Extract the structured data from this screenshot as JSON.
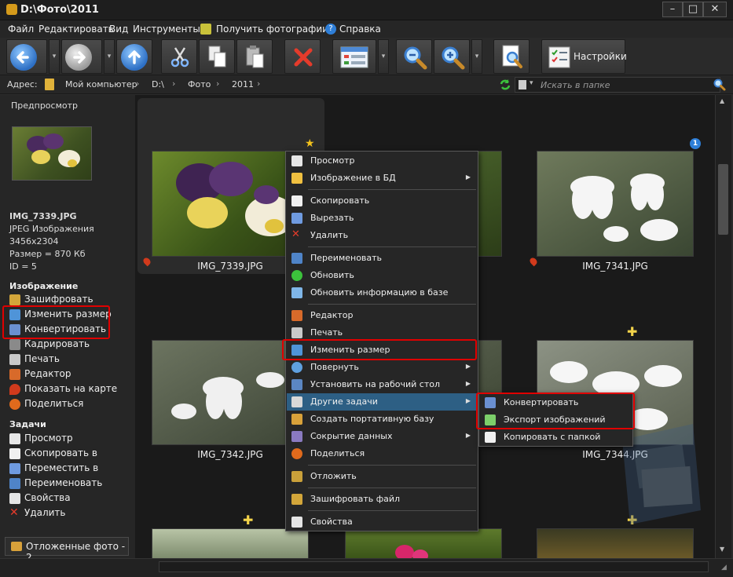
{
  "window": {
    "title": "D:\\Фото\\2011"
  },
  "menu": {
    "file": "Файл",
    "edit": "Редактировать",
    "view": "Вид",
    "tools": "Инструменты",
    "get_photos": "Получить фотографии",
    "help": "Справка"
  },
  "toolbar": {
    "settings_label": "Настройки"
  },
  "address": {
    "label": "Адрес:",
    "crumbs": [
      "Мой компьютер",
      "D:\\",
      "Фото",
      "2011"
    ],
    "search_placeholder": "Искать в папке"
  },
  "sidebar": {
    "preview_header": "Предпросмотр",
    "file": {
      "name": "IMG_7339.JPG",
      "type": "JPEG Изображения",
      "dimensions": "3456x2304",
      "size": "Размер = 870 Кб",
      "id": "ID = 5"
    },
    "image_section": {
      "header": "Изображение",
      "items": [
        "Зашифровать",
        "Изменить размер",
        "Конвертировать",
        "Кадрировать",
        "Печать",
        "Редактор",
        "Показать на карте",
        "Поделиться"
      ]
    },
    "tasks_section": {
      "header": "Задачи",
      "items": [
        "Просмотр",
        "Скопировать в",
        "Переместить в",
        "Переименовать",
        "Свойства",
        "Удалить"
      ]
    },
    "deferred": "Отложенные фото - 2"
  },
  "gallery": {
    "badge": "1",
    "captions": [
      "IMG_7339.JPG",
      "IMG_7341.JPG",
      "IMG_7342.JPG",
      "IMG_7344.JPG"
    ]
  },
  "context_menu": {
    "items": [
      "Просмотр",
      "Изображение в БД",
      "Скопировать",
      "Вырезать",
      "Удалить",
      "Переименовать",
      "Обновить",
      "Обновить информацию в базе",
      "Редактор",
      "Печать",
      "Изменить размер",
      "Повернуть",
      "Установить на рабочий стол",
      "Другие задачи",
      "Создать портативную базу",
      "Сокрытие данных",
      "Поделиться",
      "Отложить",
      "Зашифровать файл",
      "Свойства"
    ],
    "highlighted": "Другие задачи"
  },
  "submenu": {
    "items": [
      "Конвертировать",
      "Экспорт изображений",
      "Копировать с папкой"
    ]
  },
  "colors": {
    "accent": "#2d5f84",
    "highlight_border": "#e00000",
    "background": "#2b2b2b"
  }
}
